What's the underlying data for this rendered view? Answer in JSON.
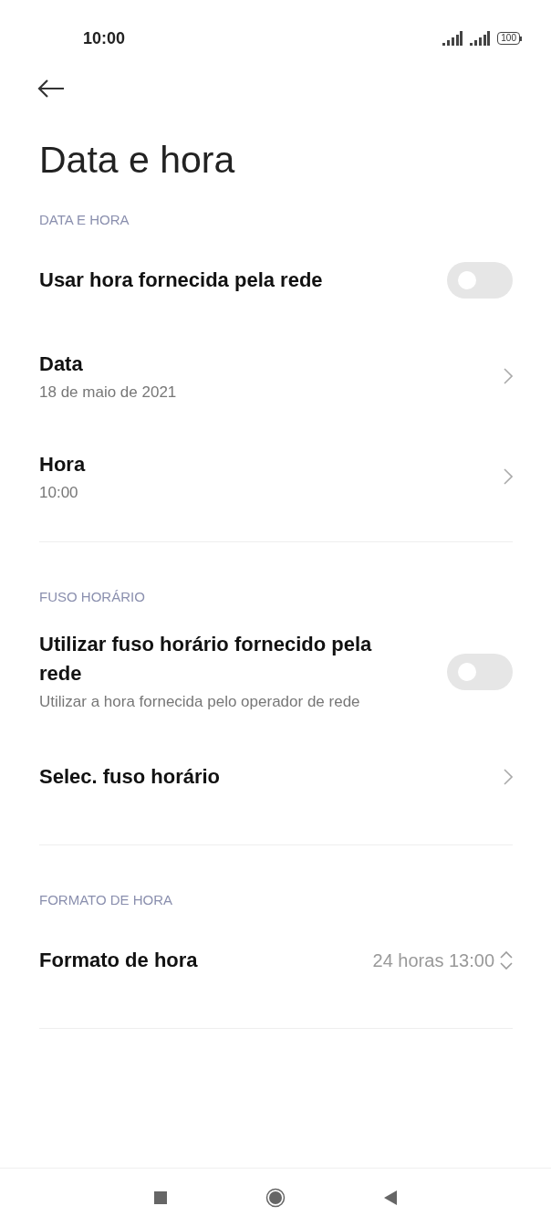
{
  "status_bar": {
    "time": "10:00",
    "battery": "100"
  },
  "title": "Data e hora",
  "sections": [
    {
      "header": "DATA E HORA",
      "items": [
        {
          "kind": "toggle",
          "title": "Usar hora fornecida pela rede",
          "on": false
        },
        {
          "kind": "link",
          "title": "Data",
          "subtitle": "18 de maio de 2021"
        },
        {
          "kind": "link",
          "title": "Hora",
          "subtitle": "10:00"
        }
      ]
    },
    {
      "header": "FUSO HORÁRIO",
      "items": [
        {
          "kind": "toggle",
          "title": "Utilizar fuso horário fornecido pela rede",
          "subtitle": "Utilizar a hora fornecida pelo operador de rede",
          "on": false
        },
        {
          "kind": "link",
          "title": "Selec. fuso horário"
        }
      ]
    },
    {
      "header": "FORMATO DE HORA",
      "items": [
        {
          "kind": "select",
          "title": "Formato de hora",
          "value": "24 horas 13:00"
        }
      ]
    }
  ]
}
